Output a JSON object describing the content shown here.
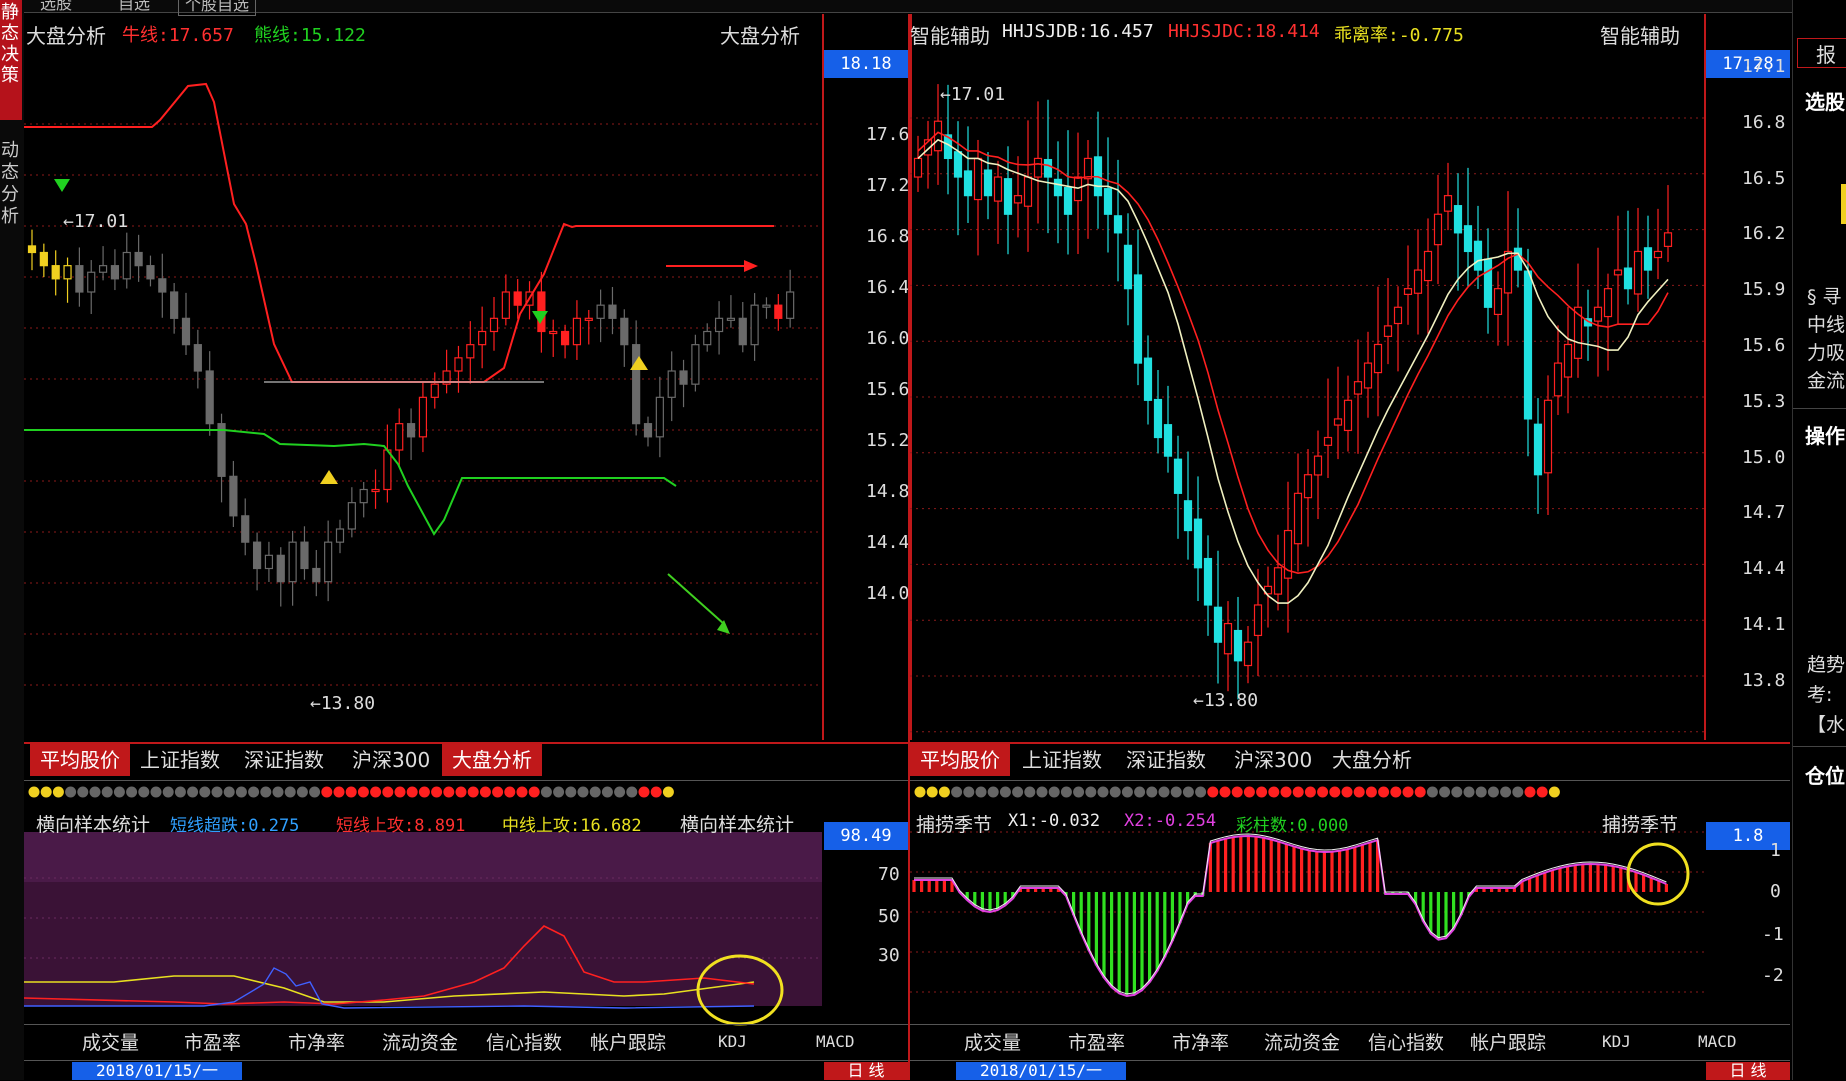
{
  "top_strip": {
    "tab1": "选股",
    "tab2": "自选",
    "tab3": "个股自选"
  },
  "left_sidebar": {
    "active_label": "静态决策",
    "label": "动态分析"
  },
  "left_panel": {
    "title": "大盘分析",
    "title_right": "大盘分析",
    "indicator1_label": "牛线:17.657",
    "indicator2_label": "熊线:15.122",
    "price_box": "18.18",
    "y_ticks": [
      "17.6",
      "17.2",
      "16.8",
      "16.4",
      "16.0",
      "15.6",
      "15.2",
      "14.8",
      "14.4",
      "14.0"
    ],
    "high_label": "17.01",
    "low_label": "13.80"
  },
  "right_panel": {
    "title": "智能辅助",
    "title_right": "智能辅助",
    "indicator1_label": "HHJSJDB:16.457",
    "indicator2_label": "HHJSJDC:18.414",
    "indicator3_label": "乖离率:-0.775",
    "price_box": "17.28",
    "y_ticks": [
      "17.1",
      "16.8",
      "16.5",
      "16.2",
      "15.9",
      "15.6",
      "15.3",
      "15.0",
      "14.7",
      "14.4",
      "14.1",
      "13.8"
    ],
    "high_label": "17.01",
    "low_label": "13.80"
  },
  "left_tabs": [
    "平均股价",
    "上证指数",
    "深证指数",
    "沪深300",
    "大盘分析"
  ],
  "right_tabs": [
    "平均股价",
    "上证指数",
    "深证指数",
    "沪深300",
    "大盘分析"
  ],
  "left_sub": {
    "title": "横向样本统计",
    "title_right": "横向样本统计",
    "l1": "短线超跌:0.275",
    "l2": "短线上攻:8.891",
    "l3": "中线上攻:16.682",
    "value_box": "98.49",
    "y_ticks": [
      "70",
      "50",
      "30"
    ]
  },
  "right_sub": {
    "title": "捕捞季节",
    "title_right": "捕捞季节",
    "l1": "X1:-0.032",
    "l2": "X2:-0.254",
    "l3": "彩柱数:0.000",
    "value_box": "1.8",
    "y_ticks": [
      "1",
      "0",
      "-1",
      "-2"
    ]
  },
  "left_bottom_tabs": [
    "成交量",
    "市盈率",
    "市净率",
    "流动资金",
    "信心指数",
    "帐户跟踪",
    "KDJ",
    "MACD"
  ],
  "right_bottom_tabs": [
    "成交量",
    "市盈率",
    "市净率",
    "流动资金",
    "信心指数",
    "帐户跟踪",
    "KDJ",
    "MACD"
  ],
  "left_status": {
    "date": "2018/01/15/一",
    "period": "日 线"
  },
  "right_status": {
    "date": "2018/01/15/一",
    "period": "日 线"
  },
  "right_sidebar": {
    "top": "报",
    "stock_pick": "选股",
    "line1": "§ 寻",
    "line2": "中线",
    "line3": "力吸",
    "line4": "金流",
    "operation": "操作",
    "trend1": "趋势",
    "trend2": "考:",
    "trend3": "【水",
    "position": "仓位"
  },
  "colors": {
    "up": "#ff2020",
    "down": "#20e0e0",
    "grid": "#8b1a1a",
    "blue_box": "#1660e8",
    "tab_active": "#c0181a"
  }
}
